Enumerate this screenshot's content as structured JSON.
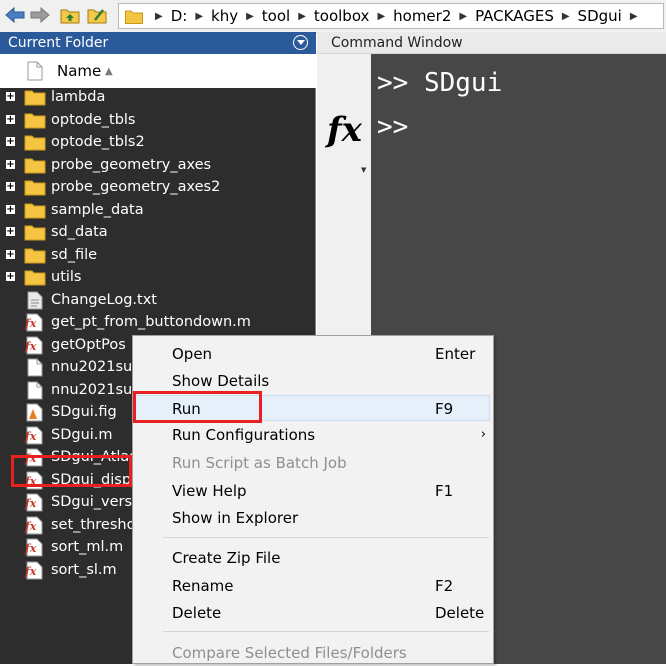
{
  "address_bar": {
    "path": [
      "D:",
      "khy",
      "tool",
      "toolbox",
      "homer2",
      "PACKAGES",
      "SDgui"
    ]
  },
  "current_folder": {
    "title": "Current Folder",
    "column_header": "Name",
    "items": [
      {
        "label": "lambda",
        "type": "folder"
      },
      {
        "label": "optode_tbls",
        "type": "folder"
      },
      {
        "label": "optode_tbls2",
        "type": "folder"
      },
      {
        "label": "probe_geometry_axes",
        "type": "folder"
      },
      {
        "label": "probe_geometry_axes2",
        "type": "folder"
      },
      {
        "label": "sample_data",
        "type": "folder"
      },
      {
        "label": "sd_data",
        "type": "folder"
      },
      {
        "label": "sd_file",
        "type": "folder"
      },
      {
        "label": "utils",
        "type": "folder"
      },
      {
        "label": "ChangeLog.txt",
        "type": "txt"
      },
      {
        "label": "get_pt_from_buttondown.m",
        "type": "m"
      },
      {
        "label": "getOptPos",
        "type": "m"
      },
      {
        "label": "nnu2021su",
        "type": "file"
      },
      {
        "label": "nnu2021su",
        "type": "file"
      },
      {
        "label": "SDgui.fig",
        "type": "fig"
      },
      {
        "label": "SDgui.m",
        "type": "m"
      },
      {
        "label": "SDgui_Atlas",
        "type": "m"
      },
      {
        "label": "SDgui_disp",
        "type": "m"
      },
      {
        "label": "SDgui_vers",
        "type": "m"
      },
      {
        "label": "set_thresho",
        "type": "m"
      },
      {
        "label": "sort_ml.m",
        "type": "m"
      },
      {
        "label": "sort_sl.m",
        "type": "m"
      }
    ]
  },
  "command_window": {
    "title": "Command Window",
    "line1": ">> SDgui",
    "line2": ">>",
    "fx_label": "fx"
  },
  "context_menu": {
    "items": [
      {
        "label": "Open",
        "shortcut": "Enter",
        "enabled": true
      },
      {
        "label": "Show Details",
        "shortcut": "",
        "enabled": true
      },
      {
        "label": "Run",
        "shortcut": "F9",
        "enabled": true,
        "highlighted": true
      },
      {
        "label": "Run Configurations",
        "shortcut": "",
        "enabled": true,
        "submenu": true
      },
      {
        "label": "Run Script as Batch Job",
        "shortcut": "",
        "enabled": false
      },
      {
        "label": "View Help",
        "shortcut": "F1",
        "enabled": true
      },
      {
        "label": "Show in Explorer",
        "shortcut": "",
        "enabled": true
      },
      {
        "label": "Create Zip File",
        "shortcut": "",
        "enabled": true
      },
      {
        "label": "Rename",
        "shortcut": "F2",
        "enabled": true
      },
      {
        "label": "Delete",
        "shortcut": "Delete",
        "enabled": true
      },
      {
        "label": "Compare Selected Files/Folders",
        "shortcut": "",
        "enabled": false
      }
    ]
  },
  "colors": {
    "panel_title_bg": "#2b5a9a",
    "list_bg": "#2d2d2d",
    "command_bg": "#474747",
    "annotation_red": "#e8201f",
    "folder_yellow": "#f5c542"
  }
}
